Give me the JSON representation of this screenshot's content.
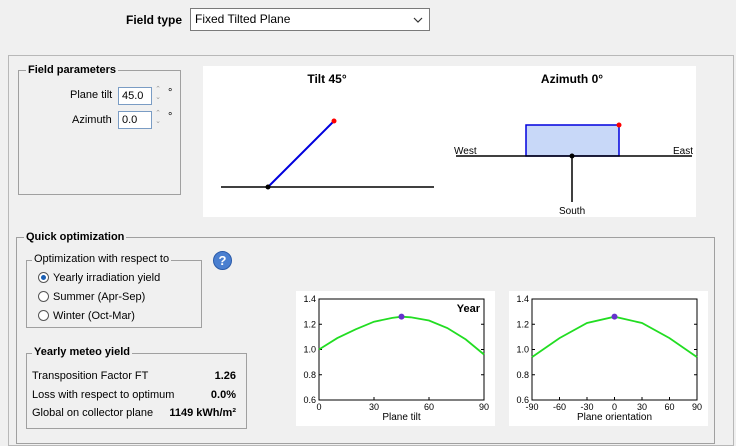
{
  "field_type": {
    "label": "Field type",
    "value": "Fixed Tilted Plane"
  },
  "field_params": {
    "title": "Field parameters",
    "tilt_label": "Plane tilt",
    "tilt_value": "45.0",
    "azimuth_label": "Azimuth",
    "azimuth_value": "0.0",
    "unit": "°"
  },
  "tilt_diagram": {
    "title": "Tilt 45°",
    "angle": 45
  },
  "azimuth_diagram": {
    "title": "Azimuth 0°",
    "west": "West",
    "east": "East",
    "south": "South",
    "angle": 0
  },
  "quick_opt": {
    "title": "Quick optimization",
    "group_title": "Optimization with respect to",
    "options": [
      "Yearly irradiation yield",
      "Summer (Apr-Sep)",
      "Winter (Oct-Mar)"
    ],
    "selected": 0,
    "help": "?"
  },
  "meteo": {
    "title": "Yearly meteo yield",
    "rows": [
      {
        "label": "Transposition Factor FT",
        "value": "1.26"
      },
      {
        "label": "Loss with respect to optimum",
        "value": "0.0%"
      },
      {
        "label": "Global on collector plane",
        "value": "1149 kWh/m²"
      }
    ]
  },
  "colors": {
    "curve": "#22dd22",
    "marker": "#6633cc",
    "line": "#0000dd",
    "box": "#c8d8f8",
    "red": "#ff0000"
  },
  "chart_data": [
    {
      "type": "line",
      "title": "Year",
      "xlabel": "Plane tilt",
      "xlim": [
        0,
        90
      ],
      "ylim": [
        0.6,
        1.4
      ],
      "xticks": [
        0,
        30,
        60,
        90
      ],
      "yticks": [
        0.6,
        0.8,
        1.0,
        1.2,
        1.4
      ],
      "ytick_labels": [
        "0.6",
        "0.8",
        "1.0",
        "1.2",
        "1.4"
      ],
      "x": [
        0,
        10,
        20,
        30,
        40,
        45,
        50,
        60,
        70,
        80,
        90
      ],
      "y": [
        1.0,
        1.09,
        1.16,
        1.22,
        1.25,
        1.26,
        1.255,
        1.23,
        1.17,
        1.08,
        0.96
      ],
      "marker": {
        "x": 45,
        "y": 1.26
      }
    },
    {
      "type": "line",
      "title": "",
      "xlabel": "Plane orientation",
      "xlim": [
        -90,
        90
      ],
      "ylim": [
        0.6,
        1.4
      ],
      "xticks": [
        -90,
        -60,
        -30,
        0,
        30,
        60,
        90
      ],
      "yticks": [
        0.6,
        0.8,
        1.0,
        1.2,
        1.4
      ],
      "ytick_labels": [
        "0.6",
        "0.8",
        "1.0",
        "1.2",
        "1.4"
      ],
      "x": [
        -90,
        -60,
        -30,
        0,
        30,
        60,
        90
      ],
      "y": [
        0.94,
        1.09,
        1.21,
        1.26,
        1.21,
        1.09,
        0.94
      ],
      "marker": {
        "x": 0,
        "y": 1.26
      }
    }
  ]
}
